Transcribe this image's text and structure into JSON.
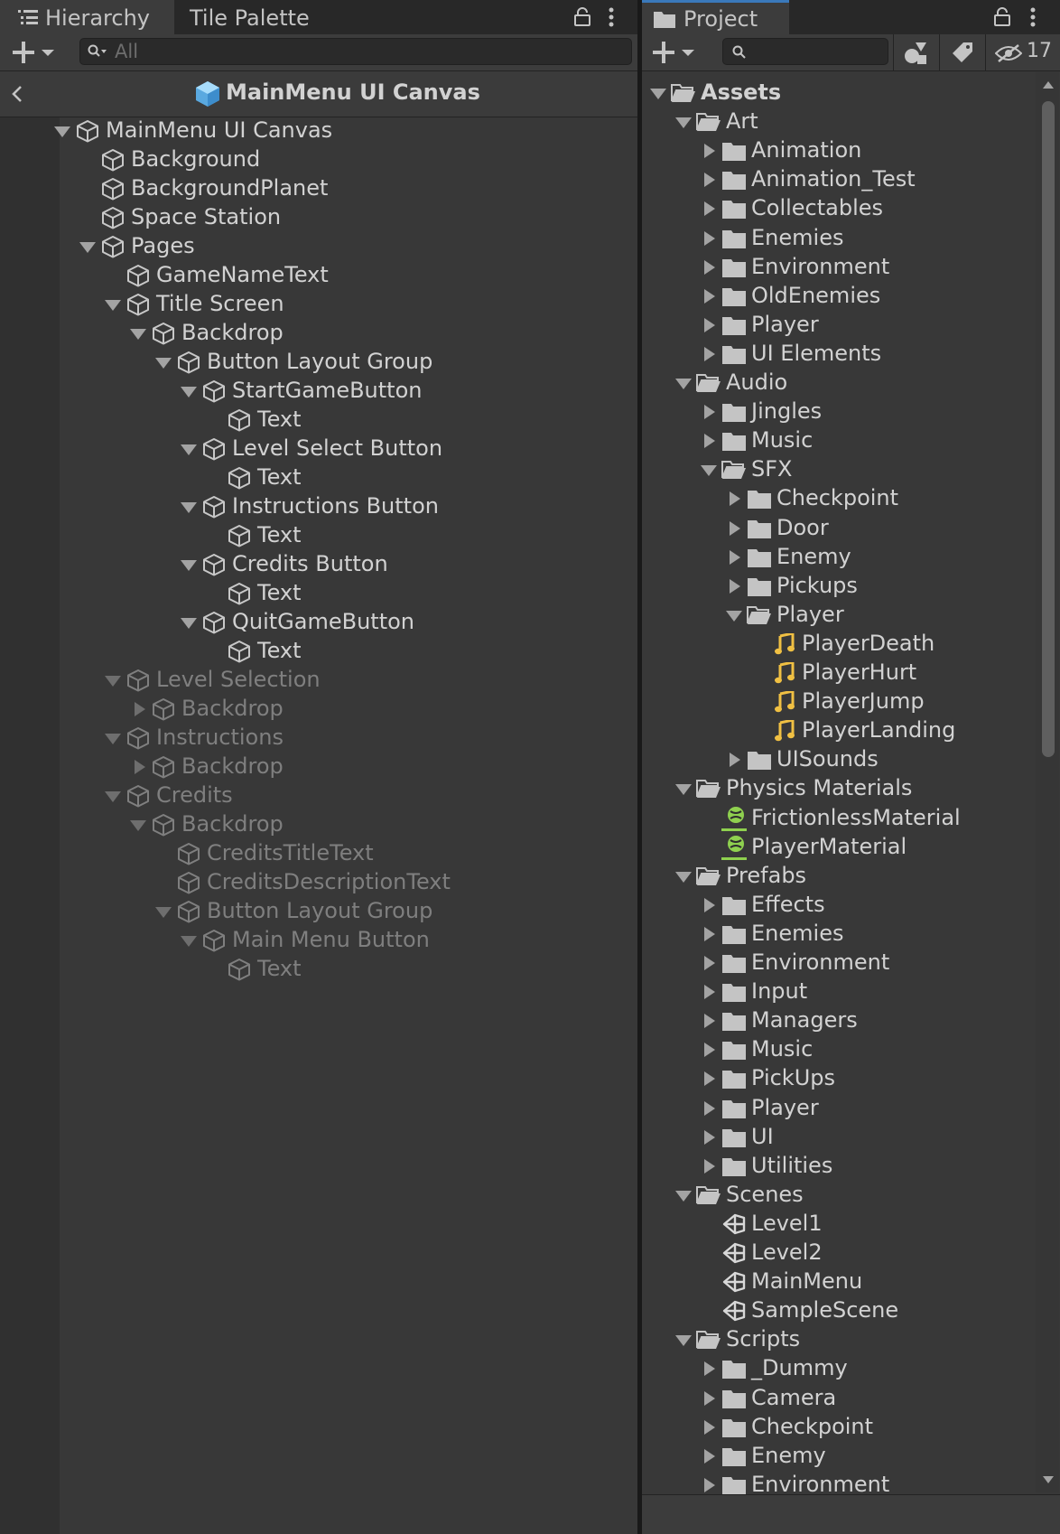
{
  "hierarchy": {
    "tabs": [
      "Hierarchy",
      "Tile Palette"
    ],
    "search_placeholder": "All",
    "breadcrumb_title": "MainMenu UI Canvas",
    "nodes": [
      {
        "label": "MainMenu UI Canvas",
        "depth": 0,
        "arrow": "down",
        "dim": false
      },
      {
        "label": "Background",
        "depth": 1,
        "arrow": "none",
        "dim": false
      },
      {
        "label": "BackgroundPlanet",
        "depth": 1,
        "arrow": "none",
        "dim": false
      },
      {
        "label": "Space Station",
        "depth": 1,
        "arrow": "none",
        "dim": false
      },
      {
        "label": "Pages",
        "depth": 1,
        "arrow": "down",
        "dim": false
      },
      {
        "label": "GameNameText",
        "depth": 2,
        "arrow": "none",
        "dim": false
      },
      {
        "label": "Title Screen",
        "depth": 2,
        "arrow": "down",
        "dim": false
      },
      {
        "label": "Backdrop",
        "depth": 3,
        "arrow": "down",
        "dim": false
      },
      {
        "label": "Button Layout Group",
        "depth": 4,
        "arrow": "down",
        "dim": false
      },
      {
        "label": "StartGameButton",
        "depth": 5,
        "arrow": "down",
        "dim": false
      },
      {
        "label": "Text",
        "depth": 6,
        "arrow": "none",
        "dim": false
      },
      {
        "label": "Level Select Button",
        "depth": 5,
        "arrow": "down",
        "dim": false
      },
      {
        "label": "Text",
        "depth": 6,
        "arrow": "none",
        "dim": false
      },
      {
        "label": "Instructions Button",
        "depth": 5,
        "arrow": "down",
        "dim": false
      },
      {
        "label": "Text",
        "depth": 6,
        "arrow": "none",
        "dim": false
      },
      {
        "label": "Credits Button",
        "depth": 5,
        "arrow": "down",
        "dim": false
      },
      {
        "label": "Text",
        "depth": 6,
        "arrow": "none",
        "dim": false
      },
      {
        "label": "QuitGameButton",
        "depth": 5,
        "arrow": "down",
        "dim": false
      },
      {
        "label": "Text",
        "depth": 6,
        "arrow": "none",
        "dim": false
      },
      {
        "label": "Level Selection",
        "depth": 2,
        "arrow": "down",
        "dim": true
      },
      {
        "label": "Backdrop",
        "depth": 3,
        "arrow": "right",
        "dim": true
      },
      {
        "label": "Instructions",
        "depth": 2,
        "arrow": "down",
        "dim": true
      },
      {
        "label": "Backdrop",
        "depth": 3,
        "arrow": "right",
        "dim": true
      },
      {
        "label": "Credits",
        "depth": 2,
        "arrow": "down",
        "dim": true
      },
      {
        "label": "Backdrop",
        "depth": 3,
        "arrow": "down",
        "dim": true
      },
      {
        "label": "CreditsTitleText",
        "depth": 4,
        "arrow": "none",
        "dim": true
      },
      {
        "label": "CreditsDescriptionText",
        "depth": 4,
        "arrow": "none",
        "dim": true
      },
      {
        "label": "Button Layout Group",
        "depth": 4,
        "arrow": "down",
        "dim": true
      },
      {
        "label": "Main Menu Button",
        "depth": 5,
        "arrow": "down",
        "dim": true
      },
      {
        "label": "Text",
        "depth": 6,
        "arrow": "none",
        "dim": true
      }
    ]
  },
  "project": {
    "tab": "Project",
    "hidden_count": "17",
    "items": [
      {
        "label": "Assets",
        "depth": 0,
        "arrow": "down",
        "icon": "folder-open",
        "bold": true
      },
      {
        "label": "Art",
        "depth": 1,
        "arrow": "down",
        "icon": "folder-open"
      },
      {
        "label": "Animation",
        "depth": 2,
        "arrow": "right",
        "icon": "folder"
      },
      {
        "label": "Animation_Test",
        "depth": 2,
        "arrow": "right",
        "icon": "folder"
      },
      {
        "label": "Collectables",
        "depth": 2,
        "arrow": "right",
        "icon": "folder"
      },
      {
        "label": "Enemies",
        "depth": 2,
        "arrow": "right",
        "icon": "folder"
      },
      {
        "label": "Environment",
        "depth": 2,
        "arrow": "right",
        "icon": "folder"
      },
      {
        "label": "OldEnemies",
        "depth": 2,
        "arrow": "right",
        "icon": "folder"
      },
      {
        "label": "Player",
        "depth": 2,
        "arrow": "right",
        "icon": "folder"
      },
      {
        "label": "UI Elements",
        "depth": 2,
        "arrow": "right",
        "icon": "folder"
      },
      {
        "label": "Audio",
        "depth": 1,
        "arrow": "down",
        "icon": "folder-open"
      },
      {
        "label": "Jingles",
        "depth": 2,
        "arrow": "right",
        "icon": "folder"
      },
      {
        "label": "Music",
        "depth": 2,
        "arrow": "right",
        "icon": "folder"
      },
      {
        "label": "SFX",
        "depth": 2,
        "arrow": "down",
        "icon": "folder-open"
      },
      {
        "label": "Checkpoint",
        "depth": 3,
        "arrow": "right",
        "icon": "folder"
      },
      {
        "label": "Door",
        "depth": 3,
        "arrow": "right",
        "icon": "folder"
      },
      {
        "label": "Enemy",
        "depth": 3,
        "arrow": "right",
        "icon": "folder"
      },
      {
        "label": "Pickups",
        "depth": 3,
        "arrow": "right",
        "icon": "folder"
      },
      {
        "label": "Player",
        "depth": 3,
        "arrow": "down",
        "icon": "folder-open"
      },
      {
        "label": "PlayerDeath",
        "depth": 4,
        "arrow": "none",
        "icon": "audio"
      },
      {
        "label": "PlayerHurt",
        "depth": 4,
        "arrow": "none",
        "icon": "audio"
      },
      {
        "label": "PlayerJump",
        "depth": 4,
        "arrow": "none",
        "icon": "audio"
      },
      {
        "label": "PlayerLanding",
        "depth": 4,
        "arrow": "none",
        "icon": "audio"
      },
      {
        "label": "UISounds",
        "depth": 3,
        "arrow": "right",
        "icon": "folder"
      },
      {
        "label": "Physics Materials",
        "depth": 1,
        "arrow": "down",
        "icon": "folder-open"
      },
      {
        "label": "FrictionlessMaterial",
        "depth": 2,
        "arrow": "none",
        "icon": "physics"
      },
      {
        "label": "PlayerMaterial",
        "depth": 2,
        "arrow": "none",
        "icon": "physics"
      },
      {
        "label": "Prefabs",
        "depth": 1,
        "arrow": "down",
        "icon": "folder-open"
      },
      {
        "label": "Effects",
        "depth": 2,
        "arrow": "right",
        "icon": "folder"
      },
      {
        "label": "Enemies",
        "depth": 2,
        "arrow": "right",
        "icon": "folder"
      },
      {
        "label": "Environment",
        "depth": 2,
        "arrow": "right",
        "icon": "folder"
      },
      {
        "label": "Input",
        "depth": 2,
        "arrow": "right",
        "icon": "folder"
      },
      {
        "label": "Managers",
        "depth": 2,
        "arrow": "right",
        "icon": "folder"
      },
      {
        "label": "Music",
        "depth": 2,
        "arrow": "right",
        "icon": "folder"
      },
      {
        "label": "PickUps",
        "depth": 2,
        "arrow": "right",
        "icon": "folder"
      },
      {
        "label": "Player",
        "depth": 2,
        "arrow": "right",
        "icon": "folder"
      },
      {
        "label": "UI",
        "depth": 2,
        "arrow": "right",
        "icon": "folder"
      },
      {
        "label": "Utilities",
        "depth": 2,
        "arrow": "right",
        "icon": "folder"
      },
      {
        "label": "Scenes",
        "depth": 1,
        "arrow": "down",
        "icon": "folder-open"
      },
      {
        "label": "Level1",
        "depth": 2,
        "arrow": "none",
        "icon": "unity-scene"
      },
      {
        "label": "Level2",
        "depth": 2,
        "arrow": "none",
        "icon": "unity-scene"
      },
      {
        "label": "MainMenu",
        "depth": 2,
        "arrow": "none",
        "icon": "unity-scene"
      },
      {
        "label": "SampleScene",
        "depth": 2,
        "arrow": "none",
        "icon": "unity-scene"
      },
      {
        "label": "Scripts",
        "depth": 1,
        "arrow": "down",
        "icon": "folder-open"
      },
      {
        "label": "_Dummy",
        "depth": 2,
        "arrow": "right",
        "icon": "folder"
      },
      {
        "label": "Camera",
        "depth": 2,
        "arrow": "right",
        "icon": "folder"
      },
      {
        "label": "Checkpoint",
        "depth": 2,
        "arrow": "right",
        "icon": "folder"
      },
      {
        "label": "Enemy",
        "depth": 2,
        "arrow": "right",
        "icon": "folder"
      },
      {
        "label": "Environment",
        "depth": 2,
        "arrow": "right",
        "icon": "folder"
      }
    ]
  },
  "colors": {
    "panel_bg": "#383838",
    "tab_bar": "#282828",
    "selected_tab_line": "#3a79bb",
    "audio_icon": "#f0c043",
    "physics_icon": "#8fd14f",
    "prefab_cube": "#7fc4f0"
  }
}
